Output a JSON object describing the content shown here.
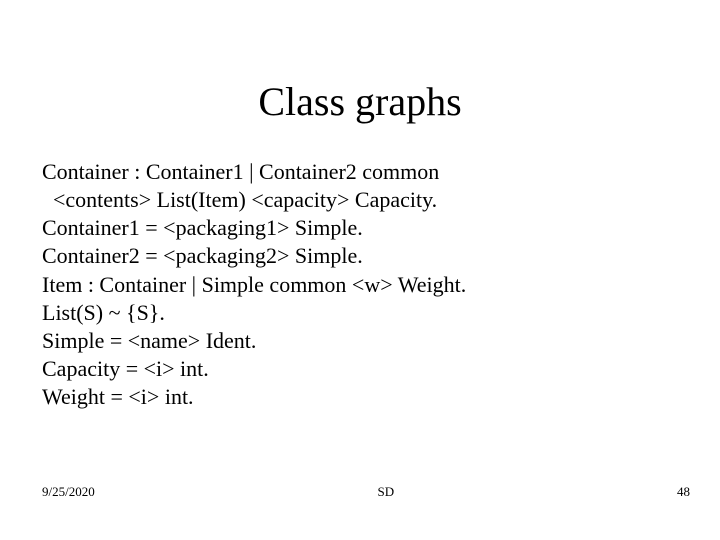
{
  "title": "Class graphs",
  "body_lines": [
    "Container : Container1 | Container2 common",
    "  <contents> List(Item) <capacity> Capacity.",
    "Container1 = <packaging1> Simple.",
    "Container2 = <packaging2> Simple.",
    "Item : Container | Simple common <w> Weight.",
    "List(S) ~ {S}.",
    "Simple = <name> Ident.",
    "Capacity = <i> int.",
    "Weight = <i> int."
  ],
  "footer": {
    "date": "9/25/2020",
    "center": "SD",
    "page": "48"
  }
}
